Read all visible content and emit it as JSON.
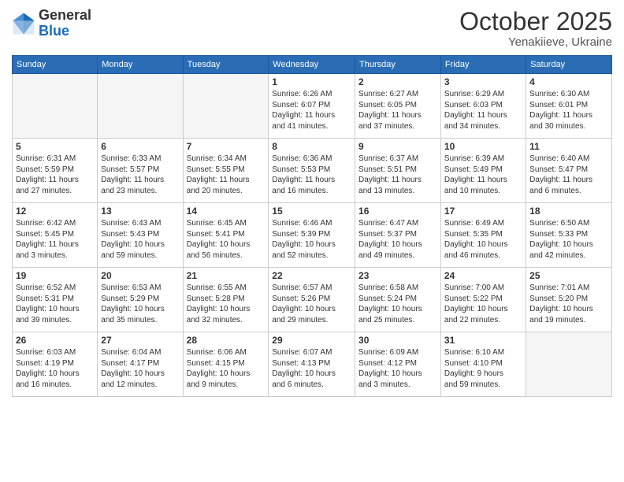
{
  "logo": {
    "general": "General",
    "blue": "Blue"
  },
  "header": {
    "month_year": "October 2025",
    "location": "Yenakiieve, Ukraine"
  },
  "days_of_week": [
    "Sunday",
    "Monday",
    "Tuesday",
    "Wednesday",
    "Thursday",
    "Friday",
    "Saturday"
  ],
  "weeks": [
    [
      {
        "day": "",
        "info": ""
      },
      {
        "day": "",
        "info": ""
      },
      {
        "day": "",
        "info": ""
      },
      {
        "day": "1",
        "info": "Sunrise: 6:26 AM\nSunset: 6:07 PM\nDaylight: 11 hours\nand 41 minutes."
      },
      {
        "day": "2",
        "info": "Sunrise: 6:27 AM\nSunset: 6:05 PM\nDaylight: 11 hours\nand 37 minutes."
      },
      {
        "day": "3",
        "info": "Sunrise: 6:29 AM\nSunset: 6:03 PM\nDaylight: 11 hours\nand 34 minutes."
      },
      {
        "day": "4",
        "info": "Sunrise: 6:30 AM\nSunset: 6:01 PM\nDaylight: 11 hours\nand 30 minutes."
      }
    ],
    [
      {
        "day": "5",
        "info": "Sunrise: 6:31 AM\nSunset: 5:59 PM\nDaylight: 11 hours\nand 27 minutes."
      },
      {
        "day": "6",
        "info": "Sunrise: 6:33 AM\nSunset: 5:57 PM\nDaylight: 11 hours\nand 23 minutes."
      },
      {
        "day": "7",
        "info": "Sunrise: 6:34 AM\nSunset: 5:55 PM\nDaylight: 11 hours\nand 20 minutes."
      },
      {
        "day": "8",
        "info": "Sunrise: 6:36 AM\nSunset: 5:53 PM\nDaylight: 11 hours\nand 16 minutes."
      },
      {
        "day": "9",
        "info": "Sunrise: 6:37 AM\nSunset: 5:51 PM\nDaylight: 11 hours\nand 13 minutes."
      },
      {
        "day": "10",
        "info": "Sunrise: 6:39 AM\nSunset: 5:49 PM\nDaylight: 11 hours\nand 10 minutes."
      },
      {
        "day": "11",
        "info": "Sunrise: 6:40 AM\nSunset: 5:47 PM\nDaylight: 11 hours\nand 6 minutes."
      }
    ],
    [
      {
        "day": "12",
        "info": "Sunrise: 6:42 AM\nSunset: 5:45 PM\nDaylight: 11 hours\nand 3 minutes."
      },
      {
        "day": "13",
        "info": "Sunrise: 6:43 AM\nSunset: 5:43 PM\nDaylight: 10 hours\nand 59 minutes."
      },
      {
        "day": "14",
        "info": "Sunrise: 6:45 AM\nSunset: 5:41 PM\nDaylight: 10 hours\nand 56 minutes."
      },
      {
        "day": "15",
        "info": "Sunrise: 6:46 AM\nSunset: 5:39 PM\nDaylight: 10 hours\nand 52 minutes."
      },
      {
        "day": "16",
        "info": "Sunrise: 6:47 AM\nSunset: 5:37 PM\nDaylight: 10 hours\nand 49 minutes."
      },
      {
        "day": "17",
        "info": "Sunrise: 6:49 AM\nSunset: 5:35 PM\nDaylight: 10 hours\nand 46 minutes."
      },
      {
        "day": "18",
        "info": "Sunrise: 6:50 AM\nSunset: 5:33 PM\nDaylight: 10 hours\nand 42 minutes."
      }
    ],
    [
      {
        "day": "19",
        "info": "Sunrise: 6:52 AM\nSunset: 5:31 PM\nDaylight: 10 hours\nand 39 minutes."
      },
      {
        "day": "20",
        "info": "Sunrise: 6:53 AM\nSunset: 5:29 PM\nDaylight: 10 hours\nand 35 minutes."
      },
      {
        "day": "21",
        "info": "Sunrise: 6:55 AM\nSunset: 5:28 PM\nDaylight: 10 hours\nand 32 minutes."
      },
      {
        "day": "22",
        "info": "Sunrise: 6:57 AM\nSunset: 5:26 PM\nDaylight: 10 hours\nand 29 minutes."
      },
      {
        "day": "23",
        "info": "Sunrise: 6:58 AM\nSunset: 5:24 PM\nDaylight: 10 hours\nand 25 minutes."
      },
      {
        "day": "24",
        "info": "Sunrise: 7:00 AM\nSunset: 5:22 PM\nDaylight: 10 hours\nand 22 minutes."
      },
      {
        "day": "25",
        "info": "Sunrise: 7:01 AM\nSunset: 5:20 PM\nDaylight: 10 hours\nand 19 minutes."
      }
    ],
    [
      {
        "day": "26",
        "info": "Sunrise: 6:03 AM\nSunset: 4:19 PM\nDaylight: 10 hours\nand 16 minutes."
      },
      {
        "day": "27",
        "info": "Sunrise: 6:04 AM\nSunset: 4:17 PM\nDaylight: 10 hours\nand 12 minutes."
      },
      {
        "day": "28",
        "info": "Sunrise: 6:06 AM\nSunset: 4:15 PM\nDaylight: 10 hours\nand 9 minutes."
      },
      {
        "day": "29",
        "info": "Sunrise: 6:07 AM\nSunset: 4:13 PM\nDaylight: 10 hours\nand 6 minutes."
      },
      {
        "day": "30",
        "info": "Sunrise: 6:09 AM\nSunset: 4:12 PM\nDaylight: 10 hours\nand 3 minutes."
      },
      {
        "day": "31",
        "info": "Sunrise: 6:10 AM\nSunset: 4:10 PM\nDaylight: 9 hours\nand 59 minutes."
      },
      {
        "day": "",
        "info": ""
      }
    ]
  ]
}
